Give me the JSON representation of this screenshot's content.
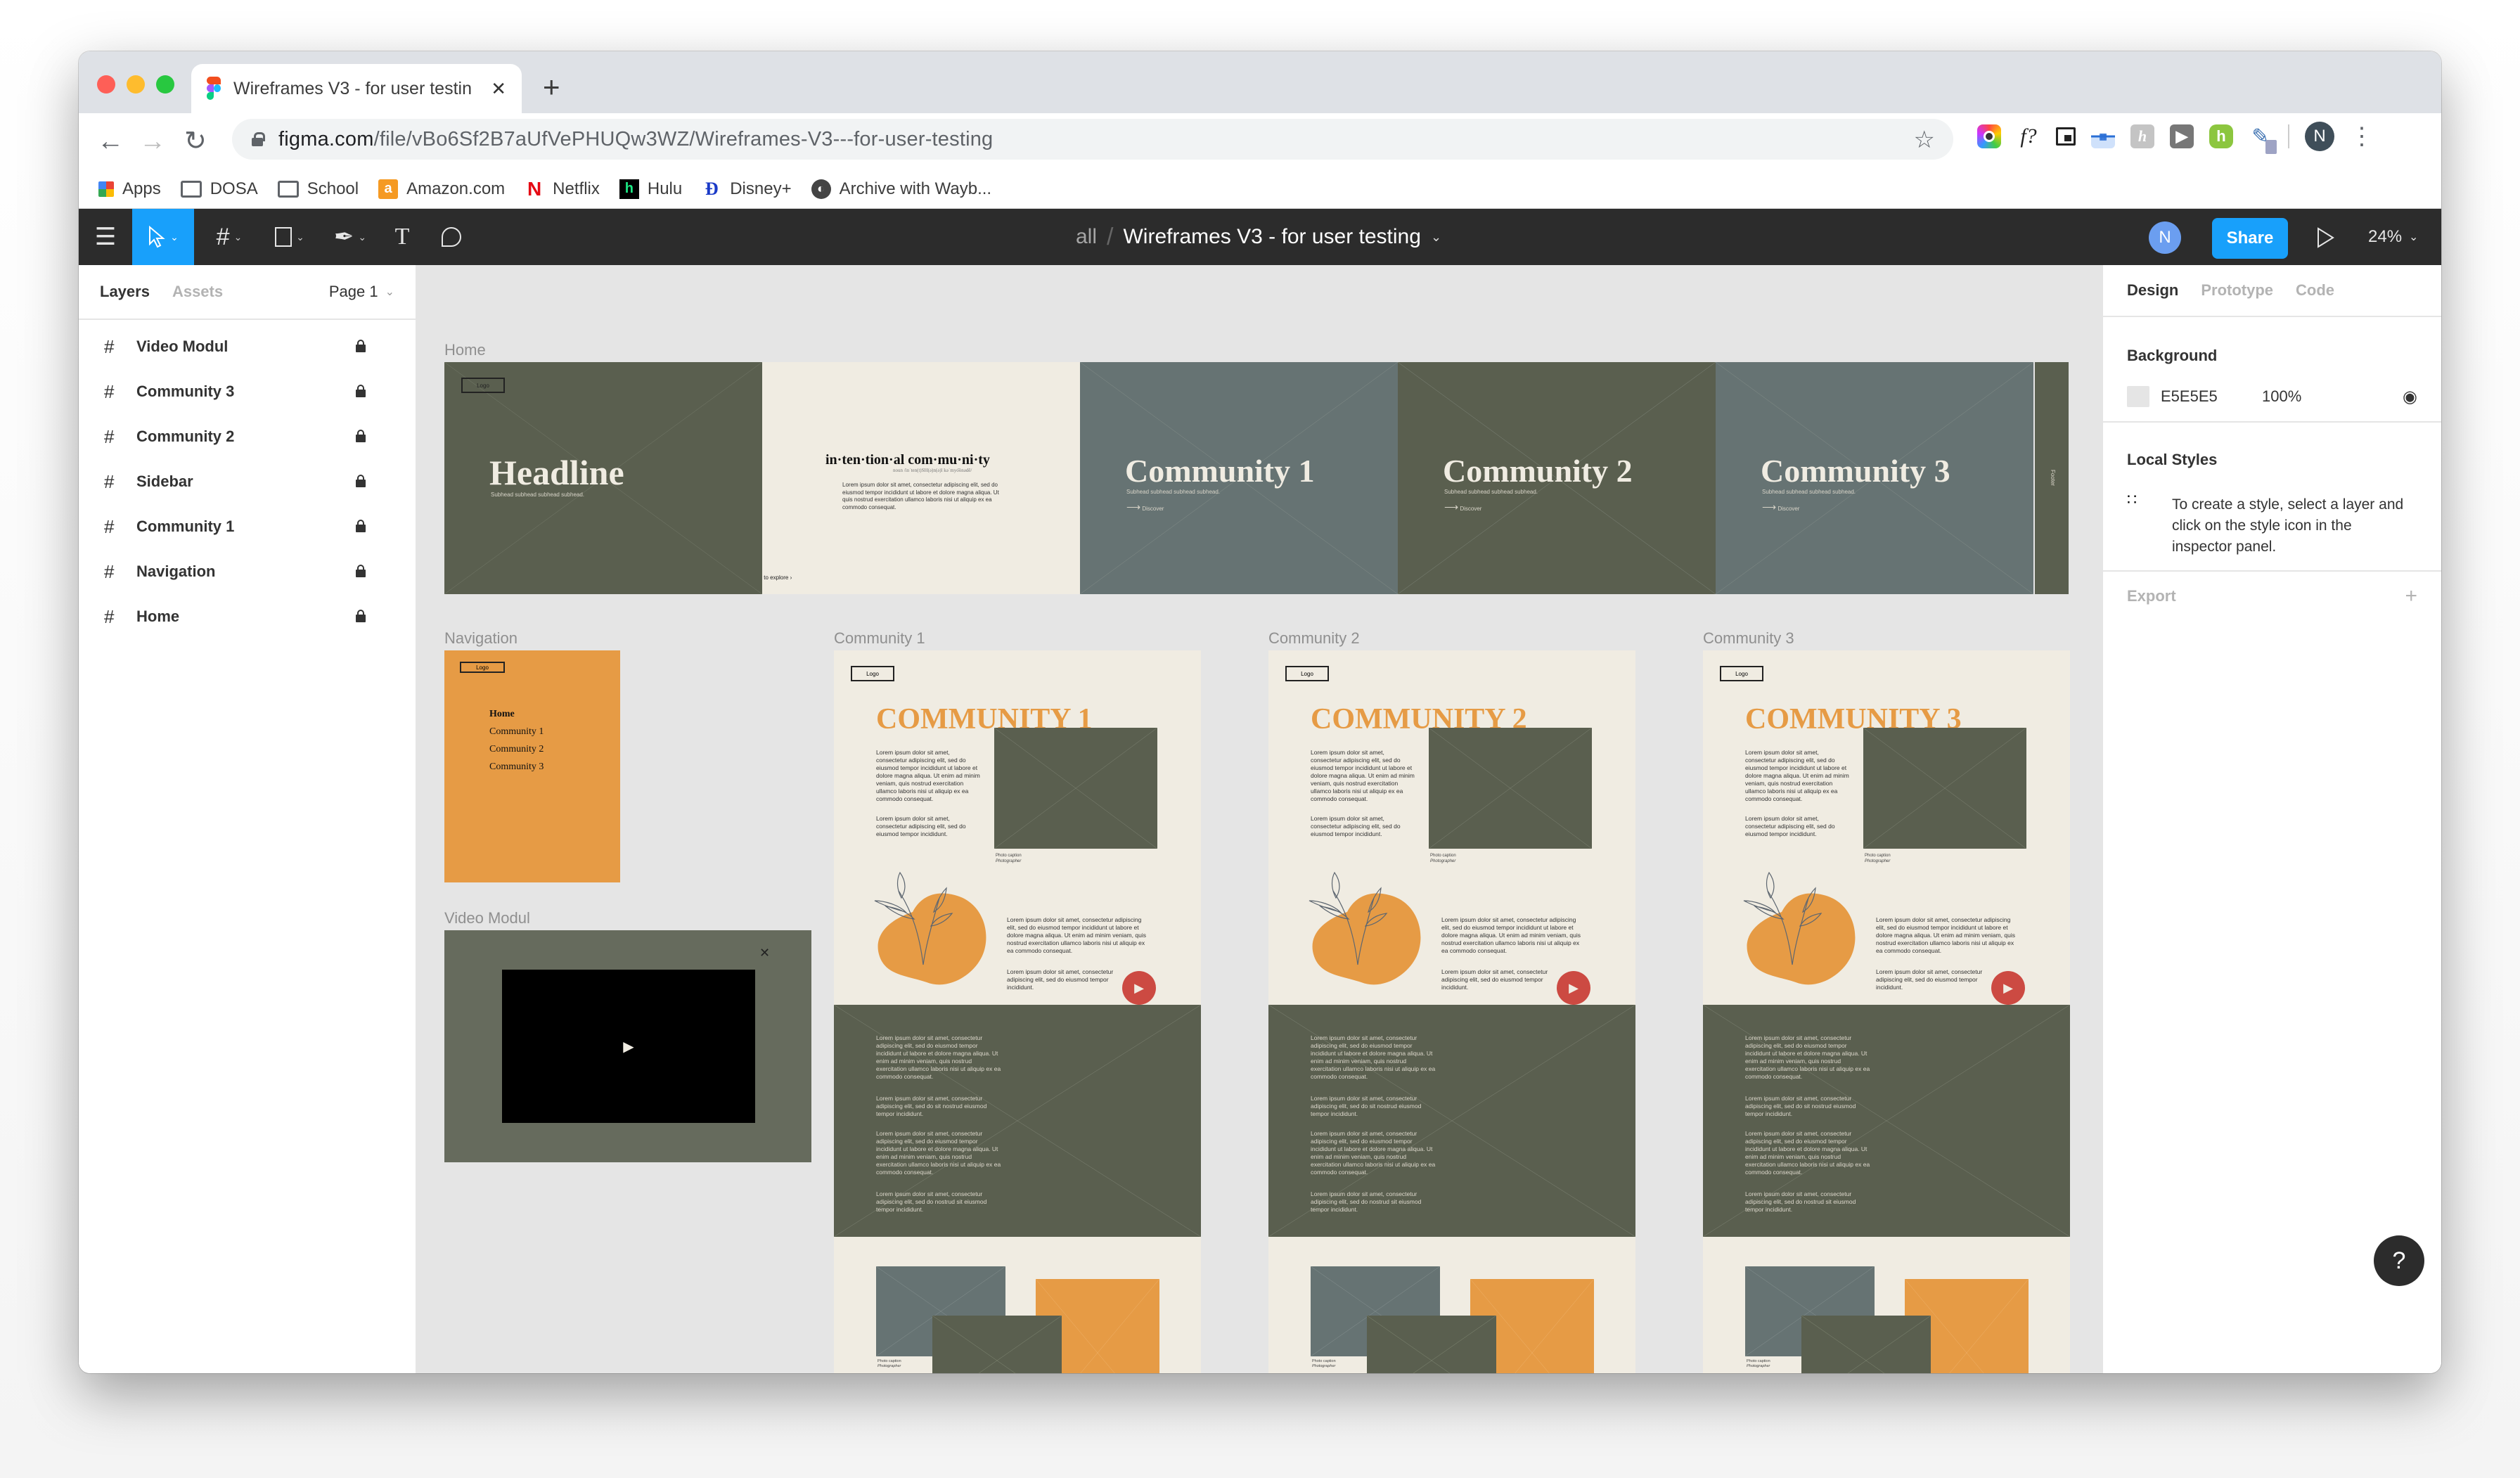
{
  "browser": {
    "tab_title": "Wireframes V3 - for user testin",
    "new_tab_label": "+",
    "url_host": "figma.com",
    "url_path": "/file/vBo6Sf2B7aUfVePHUQw3WZ/Wireframes-V3---for-user-testing",
    "bookmarks": [
      {
        "label": "Apps",
        "icon": "apps-grid-icon"
      },
      {
        "label": "DOSA",
        "icon": "folder-icon"
      },
      {
        "label": "School",
        "icon": "folder-icon"
      },
      {
        "label": "Amazon.com",
        "icon": "amazon-icon"
      },
      {
        "label": "Netflix",
        "icon": "netflix-icon"
      },
      {
        "label": "Hulu",
        "icon": "hulu-icon"
      },
      {
        "label": "Disney+",
        "icon": "disney-icon"
      },
      {
        "label": "Archive with Wayb...",
        "icon": "wayback-icon"
      }
    ],
    "extensions": [
      "camera-extension-icon",
      "font-identifier-icon",
      "picture-in-picture-icon",
      "translate-extension-icon",
      "honey-extension-icon",
      "video-extension-icon",
      "hulu-extension-icon",
      "eyedropper-extension-icon"
    ],
    "profile_initial": "N"
  },
  "figma": {
    "toolbar": {
      "tools": [
        "menu",
        "move",
        "frame",
        "rectangle",
        "pen",
        "text",
        "comment"
      ],
      "breadcrumb_team": "all",
      "file_name": "Wireframes V3 - for user testing",
      "user_initial": "N",
      "share_label": "Share",
      "zoom_level": "24%"
    },
    "left_panel": {
      "tabs": [
        "Layers",
        "Assets"
      ],
      "active_tab": "Layers",
      "page_label": "Page 1",
      "layers": [
        "Video Modul",
        "Community 3",
        "Community 2",
        "Sidebar",
        "Community 1",
        "Navigation",
        "Home"
      ]
    },
    "right_panel": {
      "tabs": [
        "Design",
        "Prototype",
        "Code"
      ],
      "active_tab": "Design",
      "background_title": "Background",
      "background_hex": "E5E5E5",
      "background_opacity": "100%",
      "local_styles_title": "Local Styles",
      "local_styles_hint": "To create a style, select a layer and click on the style icon in the inspector panel.",
      "export_title": "Export"
    },
    "help_label": "?"
  },
  "canvas": {
    "colors": {
      "olive": "#5a5f4f",
      "slate": "#667373",
      "cream": "#f0ece2",
      "orange": "#e69b45",
      "red": "#cc4a42",
      "video_bg": "#666b5d"
    },
    "home": {
      "label": "Home",
      "logo": "Logo",
      "headline": "Headline",
      "subhead": "Subhead subhead subhead subhead.",
      "definition_word": "in·ten·tion·al com·mu·ni·ty",
      "definition_pron": "noun /inˈten(t)SH(ə)n(ə)l kəˈmyo͞onədē/",
      "definition_body": "Lorem ipsum dolor sit amet, consectetur adipiscing elit, sed do eiusmod tempor incididunt ut labore et dolore magna aliqua. Ut quis nostrud exercitation ullamco laboris nisi ut aliquip ex ea commodo consequat.",
      "scroll_hint": "Scroll to explore",
      "communities": [
        {
          "title": "Community 1",
          "subhead": "Subhead subhead subhead subhead.",
          "cta": "Discover"
        },
        {
          "title": "Community 2",
          "subhead": "Subhead subhead subhead subhead.",
          "cta": "Discover"
        },
        {
          "title": "Community 3",
          "subhead": "Subhead subhead subhead subhead.",
          "cta": "Discover"
        }
      ],
      "footer": "Footer"
    },
    "navigation": {
      "label": "Navigation",
      "logo": "Logo",
      "items": [
        "Home",
        "Community 1",
        "Community 2",
        "Community 3"
      ]
    },
    "video_modul": {
      "label": "Video Modul"
    },
    "community_pages": [
      {
        "label": "Community 1",
        "heading": "COMMUNITY 1"
      },
      {
        "label": "Community 2",
        "heading": "COMMUNITY 2"
      },
      {
        "label": "Community 3",
        "heading": "COMMUNITY 3"
      }
    ],
    "community_copy": {
      "logo": "Logo",
      "intro_1": "Lorem ipsum dolor sit amet, consectetur adipiscing elit, sed do eiusmod tempor incididunt ut labore et dolore magna aliqua. Ut enim ad minim veniam, quis nostrud exercitation ullamco laboris nisi ut aliquip ex ea commodo consequat.",
      "intro_2": "Lorem ipsum dolor sit amet, consectetur adipiscing elit, sed do eiusmod tempor incididunt.",
      "photo_caption": "Photo caption",
      "photographer": "Photographer",
      "body_1": "Lorem ipsum dolor sit amet, consectetur adipiscing elit, sed do eiusmod tempor incididunt ut labore et dolore magna aliqua. Ut enim ad minim veniam, quis nostrud exercitation ullamco laboris nisi ut aliquip ex ea commodo consequat.",
      "body_2": "Lorem ipsum dolor sit amet, consectetur adipiscing elit, sed do eiusmod tempor incididunt.",
      "play_video": "PLAY VIDEO",
      "dark_1": "Lorem ipsum dolor sit amet, consectetur adipiscing elit, sed do eiusmod tempor incididunt ut labore et dolore magna aliqua. Ut enim ad minim veniam, quis nostrud exercitation ullamco laboris nisi ut aliquip ex ea commodo consequat.",
      "dark_2": "Lorem ipsum dolor sit amet, consectetur adipiscing elit, sed do sit nostrud eiusmod tempor incididunt.",
      "dark_3": "Lorem ipsum dolor sit amet, consectetur adipiscing elit, sed do eiusmod tempor incididunt ut labore et dolore magna aliqua. Ut enim ad minim veniam, quis nostrud exercitation ullamco laboris nisi ut aliquip ex ea commodo consequat.",
      "dark_4": "Lorem ipsum dolor sit amet, consectetur adipiscing elit, sed do nostrud sit eiusmod tempor incididunt."
    }
  }
}
